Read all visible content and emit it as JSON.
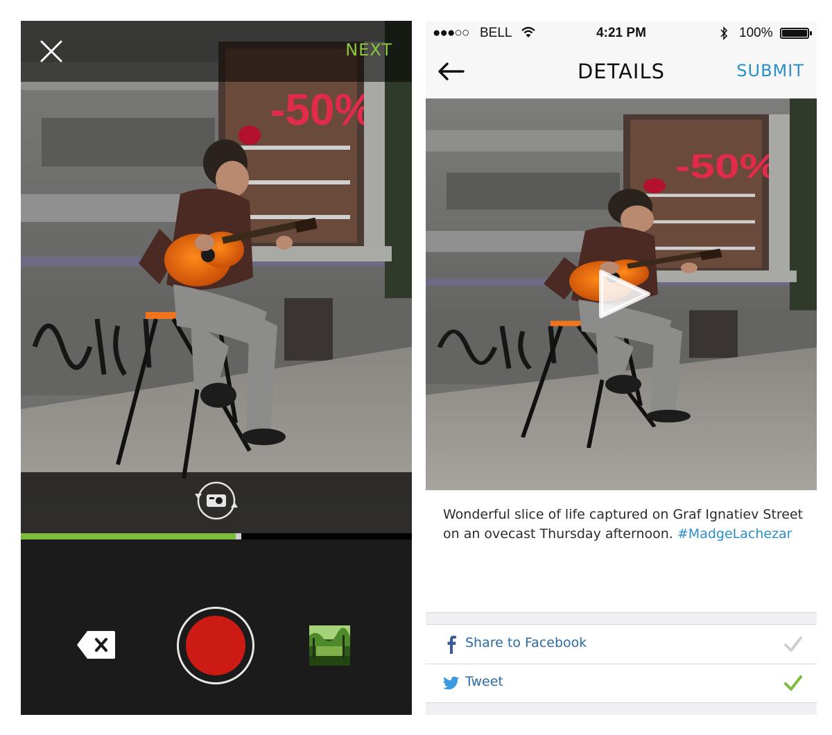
{
  "camera": {
    "next_label": "NEXT",
    "icons": {
      "close": "close-icon",
      "flip": "camera-flip-icon",
      "delete": "delete-segment-icon",
      "record": "record-button",
      "gallery": "gallery-thumbnail"
    },
    "colors": {
      "accent": "#8dc63f",
      "progress": "#7cbd3c",
      "record": "#cc1a14"
    },
    "recording_progress": 0.55
  },
  "details": {
    "status_bar": {
      "signal": "●●●○○",
      "carrier": "BELL",
      "time": "4:21 PM",
      "battery": "100%"
    },
    "nav": {
      "title": "DETAILS",
      "submit_label": "SUBMIT"
    },
    "caption": {
      "text": "Wonderful slice of life captured on Graf Ignatiev Street on an ovecast Thursday afternoon. ",
      "hashtag": "#MadgeLachezar"
    },
    "share": [
      {
        "label": "Share to Facebook",
        "icon": "facebook-icon",
        "checked": false
      },
      {
        "label": "Tweet",
        "icon": "twitter-icon",
        "checked": true
      }
    ],
    "colors": {
      "link": "#2a8fc7",
      "check_on": "#7cbd3c",
      "check_off": "#cfcfcf"
    }
  }
}
